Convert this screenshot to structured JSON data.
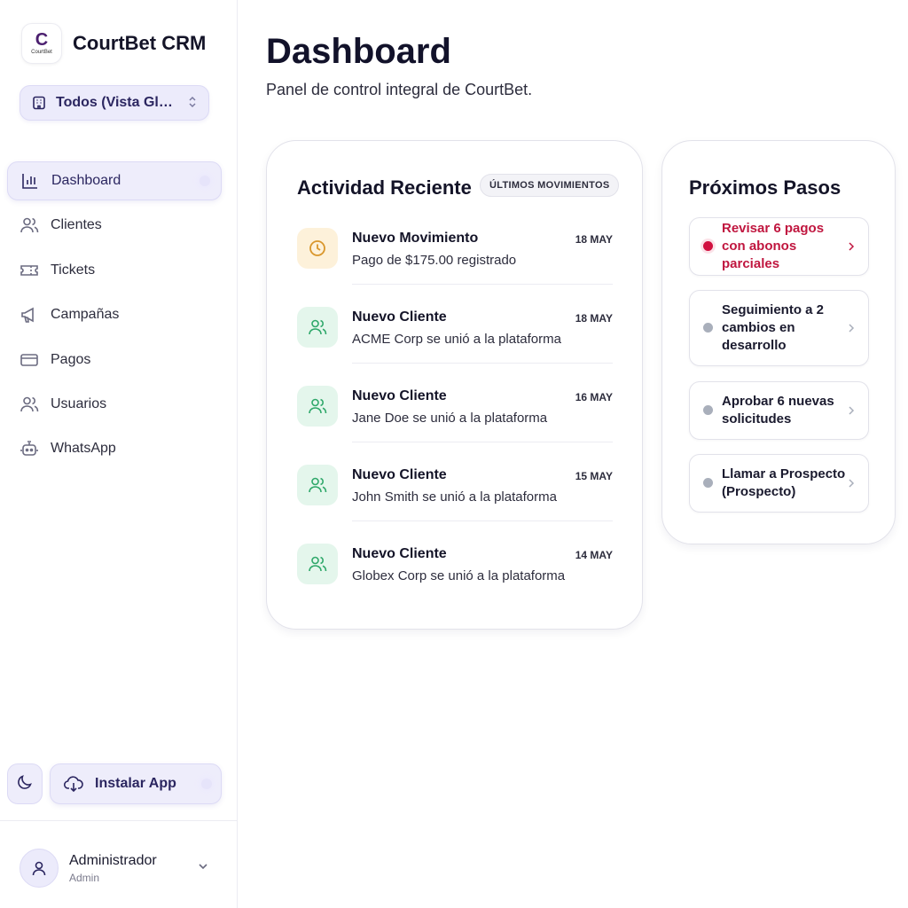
{
  "app": {
    "name": "CourtBet CRM",
    "logo_text": "CourtBet",
    "logo_letter": "C"
  },
  "scope_selector": {
    "label": "Todos (Vista Global)"
  },
  "sidebar": {
    "items": [
      {
        "label": "Dashboard",
        "icon": "bar-chart-icon",
        "active": true
      },
      {
        "label": "Clientes",
        "icon": "users-icon"
      },
      {
        "label": "Tickets",
        "icon": "ticket-icon"
      },
      {
        "label": "Campañas",
        "icon": "megaphone-icon"
      },
      {
        "label": "Pagos",
        "icon": "credit-card-icon"
      },
      {
        "label": "Usuarios",
        "icon": "users-icon"
      },
      {
        "label": "WhatsApp",
        "icon": "bot-icon"
      }
    ],
    "install_label": "Instalar App"
  },
  "user": {
    "name": "Administrador",
    "role": "Admin"
  },
  "header": {
    "title": "Dashboard",
    "subtitle": "Panel de control integral de CourtBet."
  },
  "activity": {
    "title": "Actividad Reciente",
    "tag": "ÚLTIMOS MOVIMIENTOS",
    "items": [
      {
        "type": "clock",
        "title": "Nuevo Movimiento",
        "desc": "Pago de $175.00 registrado",
        "date": "18 MAY"
      },
      {
        "type": "users",
        "title": "Nuevo Cliente",
        "desc": "ACME Corp se unió a la plataforma",
        "date": "18 MAY"
      },
      {
        "type": "users",
        "title": "Nuevo Cliente",
        "desc": "Jane Doe se unió a la plataforma",
        "date": "16 MAY"
      },
      {
        "type": "users",
        "title": "Nuevo Cliente",
        "desc": "John Smith se unió a la plataforma",
        "date": "15 MAY"
      },
      {
        "type": "users",
        "title": "Nuevo Cliente",
        "desc": "Globex Corp se unió a la plataforma",
        "date": "14 MAY"
      }
    ]
  },
  "next_steps": {
    "title": "Próximos Pasos",
    "items": [
      {
        "text": "Revisar 6 pagos con abonos parciales",
        "urgent": true
      },
      {
        "text": "Seguimiento a 2 cambios en desarrollo",
        "urgent": false
      },
      {
        "text": "Aprobar 6 nuevas solicitudes",
        "urgent": false
      },
      {
        "text": "Llamar a Prospecto (Prospecto)",
        "urgent": false
      }
    ]
  },
  "colors": {
    "accent": "#2b2660",
    "urgent": "#c0163f",
    "success": "#2fa86a",
    "warning": "#d9962b"
  }
}
